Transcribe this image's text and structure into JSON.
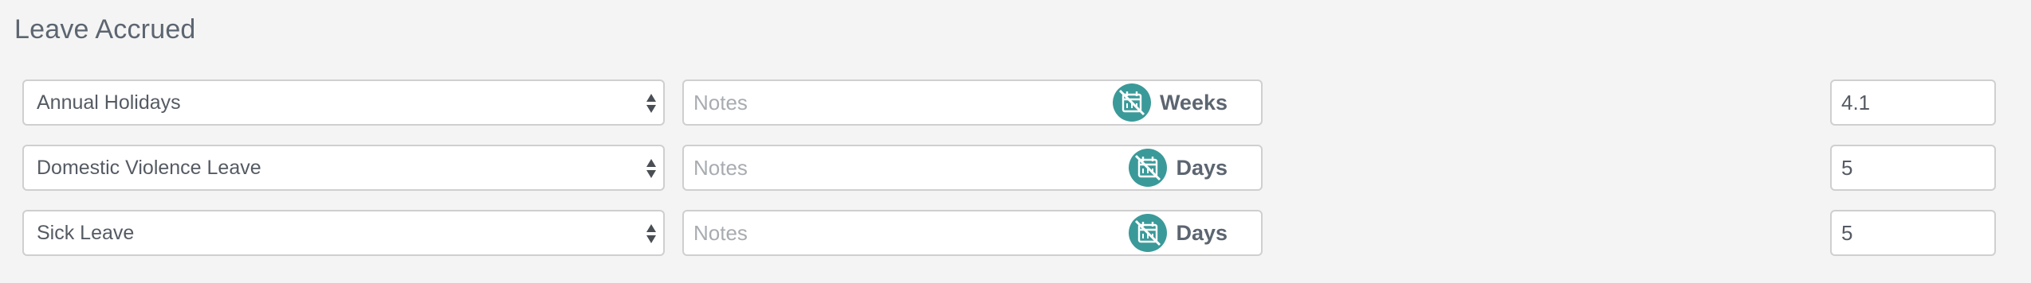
{
  "section": {
    "title": "Leave Accrued"
  },
  "colors": {
    "toggle_icon": "#3a9a99",
    "border": "#cfcfcf",
    "background": "#f4f4f4"
  },
  "rows": [
    {
      "leave_type": "Annual Holidays",
      "notes_value": "",
      "notes_placeholder": "Notes",
      "unit": "Weeks",
      "amount": "4.1",
      "icon": "no-calendar-icon"
    },
    {
      "leave_type": "Domestic Violence Leave",
      "notes_value": "",
      "notes_placeholder": "Notes",
      "unit": "Days",
      "amount": "5",
      "icon": "no-calendar-icon"
    },
    {
      "leave_type": "Sick Leave",
      "notes_value": "",
      "notes_placeholder": "Notes",
      "unit": "Days",
      "amount": "5",
      "icon": "no-calendar-icon"
    }
  ]
}
